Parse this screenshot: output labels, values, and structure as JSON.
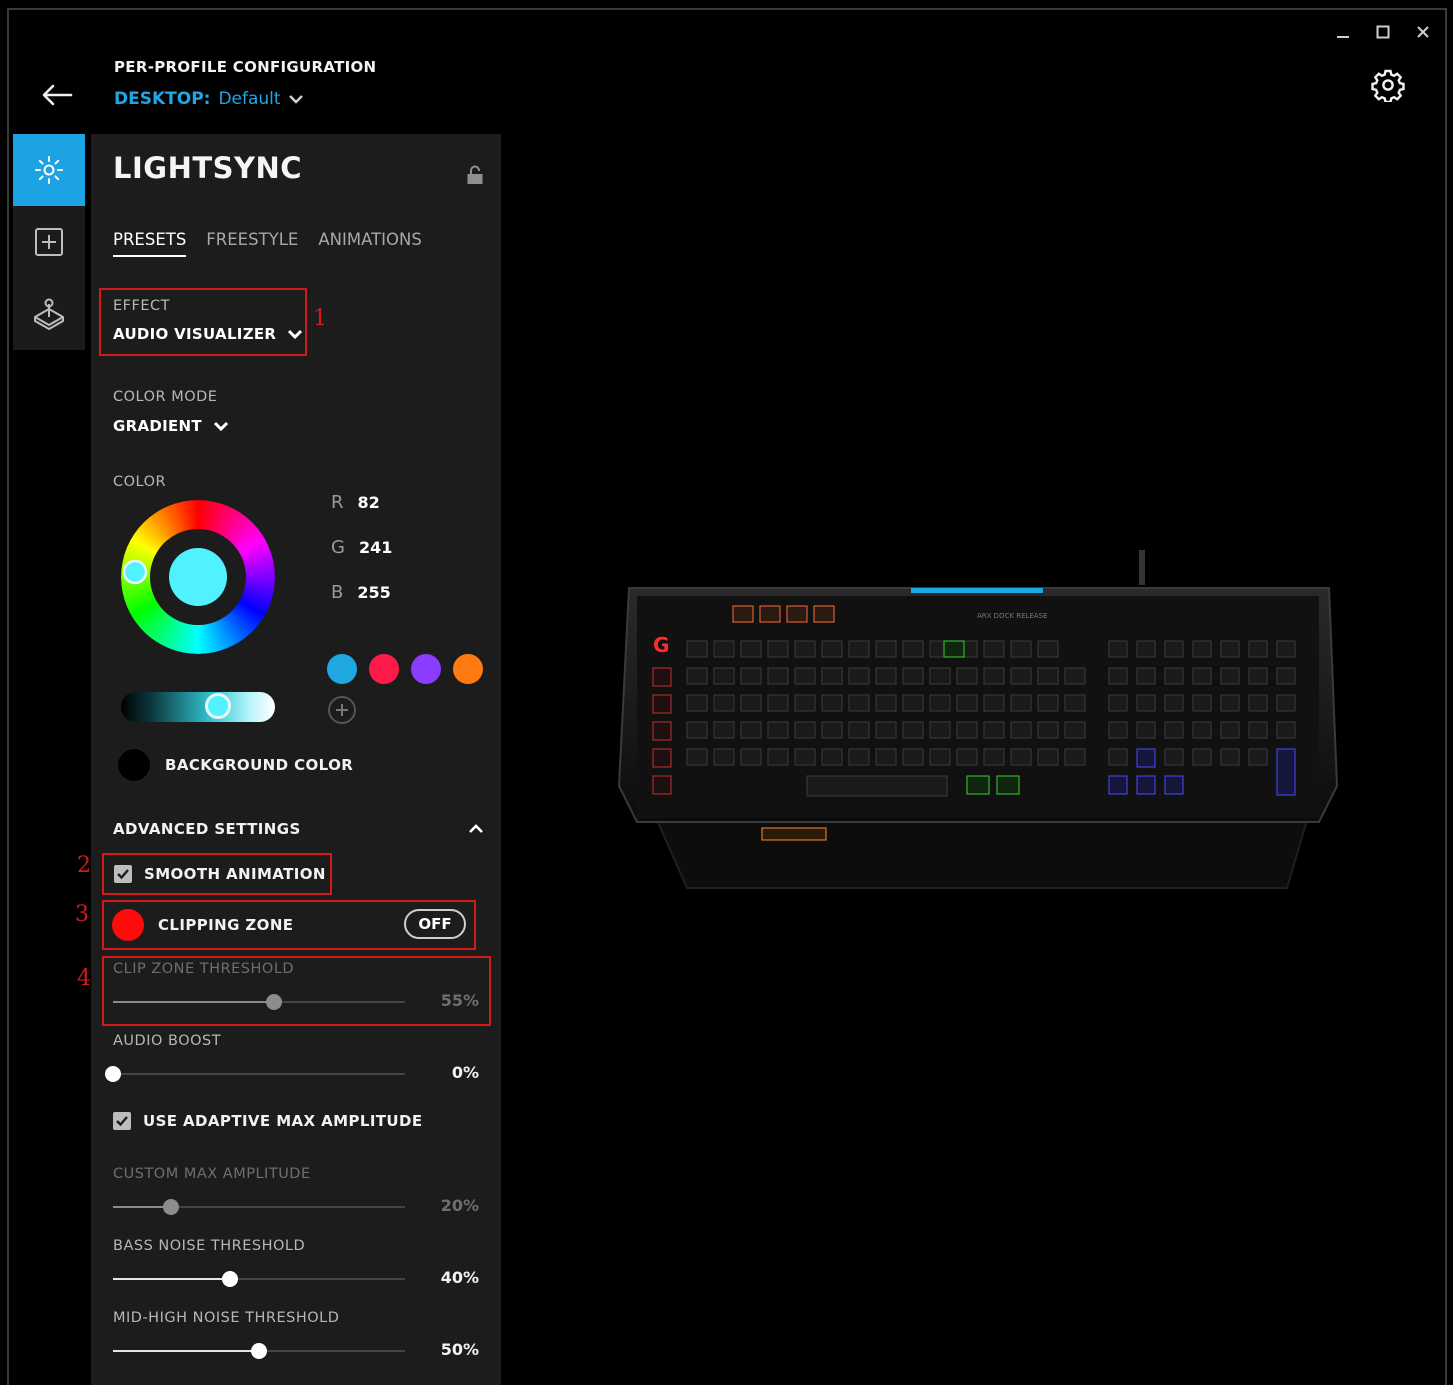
{
  "header": {
    "heading": "PER-PROFILE CONFIGURATION",
    "profile_prefix": "DESKTOP:",
    "profile_name": "Default"
  },
  "panel": {
    "title": "LIGHTSYNC",
    "tabs": [
      {
        "label": "PRESETS",
        "active": true
      },
      {
        "label": "FREESTYLE",
        "active": false
      },
      {
        "label": "ANIMATIONS",
        "active": false
      }
    ],
    "effect": {
      "label": "EFFECT",
      "value": "AUDIO VISUALIZER"
    },
    "color_mode": {
      "label": "COLOR MODE",
      "value": "GRADIENT"
    },
    "color": {
      "label": "COLOR",
      "r_label": "R",
      "r": "82",
      "g_label": "G",
      "g": "241",
      "b_label": "B",
      "b": "255",
      "preview_hex": "#52f1ff",
      "swatches": [
        "#1fa8e0",
        "#ff1a4a",
        "#8a3cff",
        "#ff7a10"
      ]
    },
    "background_color": {
      "label": "BACKGROUND COLOR",
      "hex": "#000000"
    },
    "advanced": {
      "title": "ADVANCED SETTINGS",
      "smooth_animation": {
        "label": "SMOOTH ANIMATION",
        "checked": true
      },
      "clipping_zone": {
        "label": "CLIPPING ZONE",
        "toggle": "OFF"
      },
      "clip_threshold": {
        "label": "CLIP ZONE THRESHOLD",
        "value": "55%",
        "fraction": 0.55
      },
      "audio_boost": {
        "label": "AUDIO BOOST",
        "value": "0%",
        "fraction": 0.0
      },
      "adaptive": {
        "label": "USE ADAPTIVE MAX AMPLITUDE",
        "checked": true
      },
      "custom_max": {
        "label": "CUSTOM MAX AMPLITUDE",
        "value": "20%",
        "fraction": 0.2
      },
      "bass_noise": {
        "label": "BASS NOISE THRESHOLD",
        "value": "40%",
        "fraction": 0.4
      },
      "midhigh_noise": {
        "label": "MID-HIGH NOISE THRESHOLD",
        "value": "50%",
        "fraction": 0.5
      }
    }
  },
  "annotations": [
    "1",
    "2",
    "3",
    "4"
  ],
  "keyboard": {
    "arx_label": "ARX DOCK RELEASE"
  },
  "colors": {
    "accent": "#1ba3e3",
    "annotation": "#d11a1a",
    "clip_dot": "#ff0b0b"
  }
}
